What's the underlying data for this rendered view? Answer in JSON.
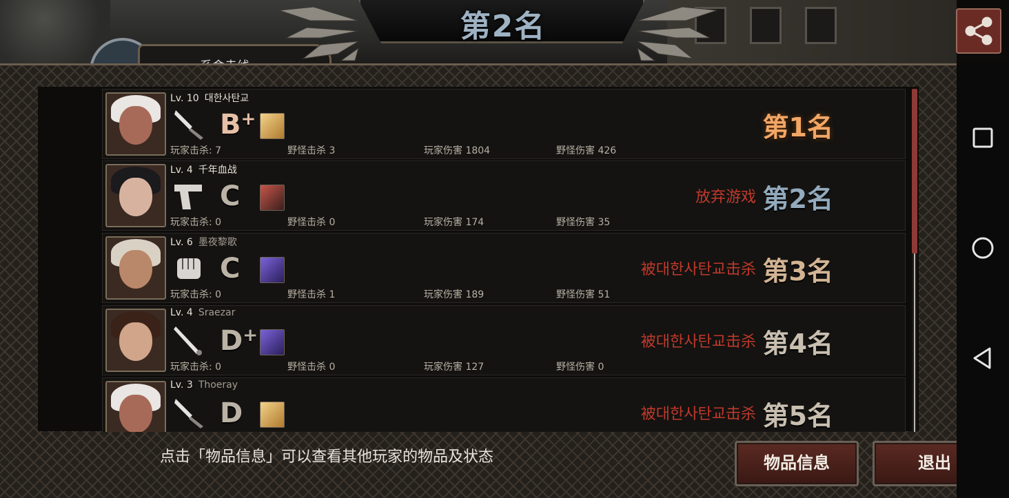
{
  "header": {
    "title": "第2名",
    "top_tab_text": "系舍走线"
  },
  "players": [
    {
      "level": "Lv. 10",
      "name": "대한사탄교",
      "weapon": "knife-icon",
      "grade": "B+",
      "item": "gold-item-icon",
      "player_kills": "玩家击杀: 7",
      "monster_kills": "野怪击杀 3",
      "player_damage": "玩家伤害 1804",
      "monster_damage": "野怪伤害 426",
      "result": "",
      "rank": "第1名"
    },
    {
      "level": "Lv. 4",
      "name": "千年血战",
      "weapon": "pistol-icon",
      "grade": "C",
      "item": "binocular-item-icon",
      "player_kills": "玩家击杀: 0",
      "monster_kills": "野怪击杀 0",
      "player_damage": "玩家伤害 174",
      "monster_damage": "野怪伤害 35",
      "result": "放弃游戏",
      "rank": "第2名"
    },
    {
      "level": "Lv. 6",
      "name": "墨夜黎歌",
      "weapon": "fist-icon",
      "grade": "C",
      "item": "purple-item-icon",
      "player_kills": "玩家击杀: 0",
      "monster_kills": "野怪击杀 1",
      "player_damage": "玩家伤害 189",
      "monster_damage": "野怪伤害 51",
      "result": "被대한사탄교击杀",
      "rank": "第3名"
    },
    {
      "level": "Lv. 4",
      "name": "Sraezar",
      "weapon": "bat-icon",
      "grade": "D+",
      "item": "purple-item-icon",
      "player_kills": "玩家击杀: 0",
      "monster_kills": "野怪击杀 0",
      "player_damage": "玩家伤害 127",
      "monster_damage": "野怪伤害 0",
      "result": "被대한사탄교击杀",
      "rank": "第4名"
    },
    {
      "level": "Lv. 3",
      "name": "Thoeray",
      "weapon": "knife-icon",
      "grade": "D",
      "item": "gold-item-icon",
      "player_kills": "",
      "monster_kills": "",
      "player_damage": "",
      "monster_damage": "",
      "result": "被대한사탄교击杀",
      "rank": "第5名"
    }
  ],
  "footer": {
    "hint": "点击「物品信息」可以查看其他玩家的物品及状态",
    "items_button": "物品信息",
    "exit_button": "退出"
  },
  "colors": {
    "accent_red": "#c0392b",
    "first_rank": "#f2a766",
    "button_bg": "#5a2a22"
  },
  "scroll_fraction": 0.48
}
